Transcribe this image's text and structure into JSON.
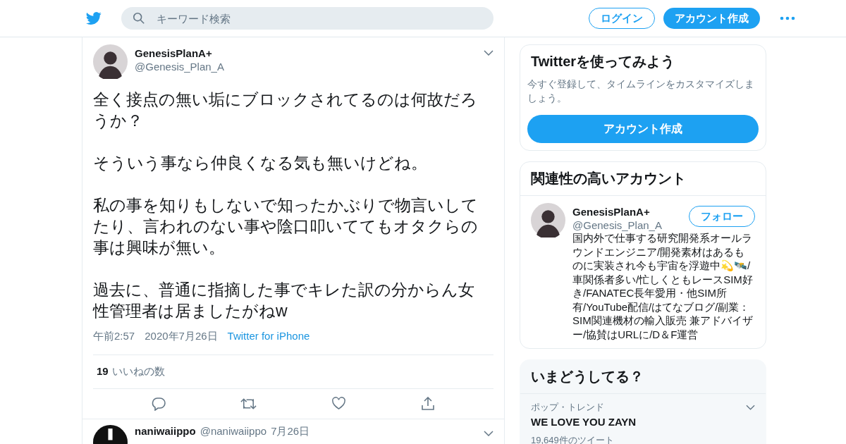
{
  "header": {
    "search": {
      "placeholder": "キーワード検索"
    },
    "login": "ログイン",
    "signup": "アカウント作成"
  },
  "tweet": {
    "name": "GenesisPlanA+",
    "handle": "@Genesis_Plan_A",
    "paragraphs": [
      "全く接点の無い垢にブロックされてるのは何故だろうか？",
      "そういう事なら仲良くなる気も無いけどね。",
      "私の事を知りもしないで知ったかぶりで物言いしてたり、言われのない事や陰口叩いててもオタクらの事は興味が無い。",
      "過去に、普通に指摘した事でキレた訳の分からん女性管理者は居ましたがねw"
    ],
    "time": "午前2:57",
    "date": "2020年7月26日",
    "source": "Twitter for iPhone",
    "likes_count": "19",
    "likes_label": "いいねの数"
  },
  "next_tweet": {
    "name": "naniwaiippo",
    "handle": "@naniwaiippo",
    "date": "7月26日"
  },
  "signup_card": {
    "title": "Twitterを使ってみよう",
    "text": "今すぐ登録して、タイムラインをカスタマイズしましょう。",
    "button": "アカウント作成"
  },
  "related": {
    "title": "関連性の高いアカウント",
    "account": {
      "name": "GenesisPlanA+",
      "handle": "@Genesis_Plan_A",
      "follow": "フォロー",
      "bio": "国内外で仕事する研究開発系オールラウンドエンジニア/開発素材はあるものに実装され今も宇宙を浮遊中💫🛰️/車関係者多い/忙しくともレースSIM好き/FANATEC長年愛用・他SIM所有/YouTube配信/はてなブログ/副業：SIM関連機材の輸入販売 兼アドバイザー/協賛はURLに/D＆F運営"
    }
  },
  "trends": {
    "title": "いまどうしてる？",
    "items": [
      {
        "category": "ポップ・トレンド",
        "name": "WE LOVE YOU ZAYN",
        "count": "19,649件のツイート"
      }
    ]
  }
}
